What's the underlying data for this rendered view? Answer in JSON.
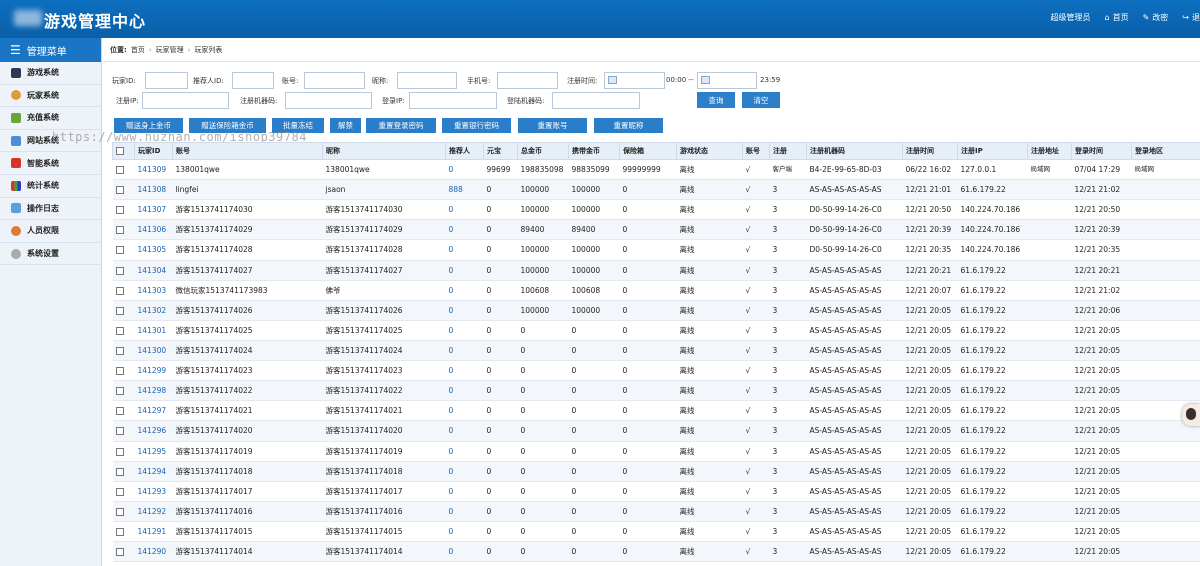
{
  "header": {
    "title": "游戏管理中心",
    "user": "超级管理员",
    "home": "首页",
    "change_pwd": "改密",
    "logout": "退"
  },
  "sidebar": {
    "title": "管理菜单",
    "items": [
      {
        "label": "游戏系统",
        "icon": "monitor-icon"
      },
      {
        "label": "玩家系统",
        "icon": "users-icon"
      },
      {
        "label": "充值系统",
        "icon": "money-icon"
      },
      {
        "label": "网站系统",
        "icon": "web-icon"
      },
      {
        "label": "智能系统",
        "icon": "app-icon"
      },
      {
        "label": "统计系统",
        "icon": "chart-icon"
      },
      {
        "label": "操作日志",
        "icon": "log-icon"
      },
      {
        "label": "人员权限",
        "icon": "person-icon"
      },
      {
        "label": "系统设置",
        "icon": "settings-icon"
      }
    ]
  },
  "breadcrumb": {
    "prefix": "位置:",
    "items": [
      "首页",
      "玩家管理",
      "玩家列表"
    ]
  },
  "filters": {
    "player_id": "玩家ID:",
    "referrer_id": "推荐人ID:",
    "account": "账号:",
    "nickname": "昵称:",
    "phone": "手机号:",
    "reg_time": "注册时间:",
    "time_start": "00:00 --",
    "time_end": "23:59",
    "reg_ip": "注册IP:",
    "reg_machine": "注册机器码:",
    "login_ip": "登录IP:",
    "login_machine": "登陆机器码:",
    "query_btn": "查询",
    "clear_btn": "清空"
  },
  "actions": [
    "赠送身上金币",
    "赠送保险箱金币",
    "批量冻结",
    "解禁",
    "重置登录密码",
    "重置银行密码",
    "重置账号",
    "重置昵称"
  ],
  "watermark": "https://www.huzhan.com/ishop39784",
  "table": {
    "headers": [
      "玩家ID",
      "账号",
      "昵称",
      "推荐人",
      "元宝",
      "总金币",
      "携带金币",
      "保险箱",
      "游戏状态",
      "账号",
      "注册",
      "注册机器码",
      "注册时间",
      "注册IP",
      "注册地址",
      "登录时间",
      "登录地区"
    ],
    "rows": [
      [
        "141309",
        "138001qwe",
        "138001qwe",
        "0",
        "99699",
        "198835098",
        "98835099",
        "99999999",
        "离线",
        "√",
        "客户端",
        "B4-2E-99-65-8D-03",
        "06/22 16:02",
        "127.0.0.1",
        "局域网",
        "07/04 17:29",
        "局域网"
      ],
      [
        "141308",
        "lingfei",
        "jsaon",
        "888",
        "0",
        "100000",
        "100000",
        "0",
        "离线",
        "√",
        "3",
        "AS-AS-AS-AS-AS-AS",
        "12/21 21:01",
        "61.6.179.22",
        "",
        "12/21 21:02",
        ""
      ],
      [
        "141307",
        "游客1513741174030",
        "游客1513741174030",
        "0",
        "0",
        "100000",
        "100000",
        "0",
        "离线",
        "√",
        "3",
        "D0-50-99-14-26-C0",
        "12/21 20:50",
        "140.224.70.186",
        "",
        "12/21 20:50",
        ""
      ],
      [
        "141306",
        "游客1513741174029",
        "游客1513741174029",
        "0",
        "0",
        "89400",
        "89400",
        "0",
        "离线",
        "√",
        "3",
        "D0-50-99-14-26-C0",
        "12/21 20:39",
        "140.224.70.186",
        "",
        "12/21 20:39",
        ""
      ],
      [
        "141305",
        "游客1513741174028",
        "游客1513741174028",
        "0",
        "0",
        "100000",
        "100000",
        "0",
        "离线",
        "√",
        "3",
        "D0-50-99-14-26-C0",
        "12/21 20:35",
        "140.224.70.186",
        "",
        "12/21 20:35",
        ""
      ],
      [
        "141304",
        "游客1513741174027",
        "游客1513741174027",
        "0",
        "0",
        "100000",
        "100000",
        "0",
        "离线",
        "√",
        "3",
        "AS-AS-AS-AS-AS-AS",
        "12/21 20:21",
        "61.6.179.22",
        "",
        "12/21 20:21",
        ""
      ],
      [
        "141303",
        "微信玩家1513741173983",
        "佛爷",
        "0",
        "0",
        "100608",
        "100608",
        "0",
        "离线",
        "√",
        "3",
        "AS-AS-AS-AS-AS-AS",
        "12/21 20:07",
        "61.6.179.22",
        "",
        "12/21 21:02",
        ""
      ],
      [
        "141302",
        "游客1513741174026",
        "游客1513741174026",
        "0",
        "0",
        "100000",
        "100000",
        "0",
        "离线",
        "√",
        "3",
        "AS-AS-AS-AS-AS-AS",
        "12/21 20:05",
        "61.6.179.22",
        "",
        "12/21 20:06",
        ""
      ],
      [
        "141301",
        "游客1513741174025",
        "游客1513741174025",
        "0",
        "0",
        "0",
        "0",
        "0",
        "离线",
        "√",
        "3",
        "AS-AS-AS-AS-AS-AS",
        "12/21 20:05",
        "61.6.179.22",
        "",
        "12/21 20:05",
        ""
      ],
      [
        "141300",
        "游客1513741174024",
        "游客1513741174024",
        "0",
        "0",
        "0",
        "0",
        "0",
        "离线",
        "√",
        "3",
        "AS-AS-AS-AS-AS-AS",
        "12/21 20:05",
        "61.6.179.22",
        "",
        "12/21 20:05",
        ""
      ],
      [
        "141299",
        "游客1513741174023",
        "游客1513741174023",
        "0",
        "0",
        "0",
        "0",
        "0",
        "离线",
        "√",
        "3",
        "AS-AS-AS-AS-AS-AS",
        "12/21 20:05",
        "61.6.179.22",
        "",
        "12/21 20:05",
        ""
      ],
      [
        "141298",
        "游客1513741174022",
        "游客1513741174022",
        "0",
        "0",
        "0",
        "0",
        "0",
        "离线",
        "√",
        "3",
        "AS-AS-AS-AS-AS-AS",
        "12/21 20:05",
        "61.6.179.22",
        "",
        "12/21 20:05",
        ""
      ],
      [
        "141297",
        "游客1513741174021",
        "游客1513741174021",
        "0",
        "0",
        "0",
        "0",
        "0",
        "离线",
        "√",
        "3",
        "AS-AS-AS-AS-AS-AS",
        "12/21 20:05",
        "61.6.179.22",
        "",
        "12/21 20:05",
        ""
      ],
      [
        "141296",
        "游客1513741174020",
        "游客1513741174020",
        "0",
        "0",
        "0",
        "0",
        "0",
        "离线",
        "√",
        "3",
        "AS-AS-AS-AS-AS-AS",
        "12/21 20:05",
        "61.6.179.22",
        "",
        "12/21 20:05",
        ""
      ],
      [
        "141295",
        "游客1513741174019",
        "游客1513741174019",
        "0",
        "0",
        "0",
        "0",
        "0",
        "离线",
        "√",
        "3",
        "AS-AS-AS-AS-AS-AS",
        "12/21 20:05",
        "61.6.179.22",
        "",
        "12/21 20:05",
        ""
      ],
      [
        "141294",
        "游客1513741174018",
        "游客1513741174018",
        "0",
        "0",
        "0",
        "0",
        "0",
        "离线",
        "√",
        "3",
        "AS-AS-AS-AS-AS-AS",
        "12/21 20:05",
        "61.6.179.22",
        "",
        "12/21 20:05",
        ""
      ],
      [
        "141293",
        "游客1513741174017",
        "游客1513741174017",
        "0",
        "0",
        "0",
        "0",
        "0",
        "离线",
        "√",
        "3",
        "AS-AS-AS-AS-AS-AS",
        "12/21 20:05",
        "61.6.179.22",
        "",
        "12/21 20:05",
        ""
      ],
      [
        "141292",
        "游客1513741174016",
        "游客1513741174016",
        "0",
        "0",
        "0",
        "0",
        "0",
        "离线",
        "√",
        "3",
        "AS-AS-AS-AS-AS-AS",
        "12/21 20:05",
        "61.6.179.22",
        "",
        "12/21 20:05",
        ""
      ],
      [
        "141291",
        "游客1513741174015",
        "游客1513741174015",
        "0",
        "0",
        "0",
        "0",
        "0",
        "离线",
        "√",
        "3",
        "AS-AS-AS-AS-AS-AS",
        "12/21 20:05",
        "61.6.179.22",
        "",
        "12/21 20:05",
        ""
      ],
      [
        "141290",
        "游客1513741174014",
        "游客1513741174014",
        "0",
        "0",
        "0",
        "0",
        "0",
        "离线",
        "√",
        "3",
        "AS-AS-AS-AS-AS-AS",
        "12/21 20:05",
        "61.6.179.22",
        "",
        "12/21 20:05",
        ""
      ]
    ]
  }
}
